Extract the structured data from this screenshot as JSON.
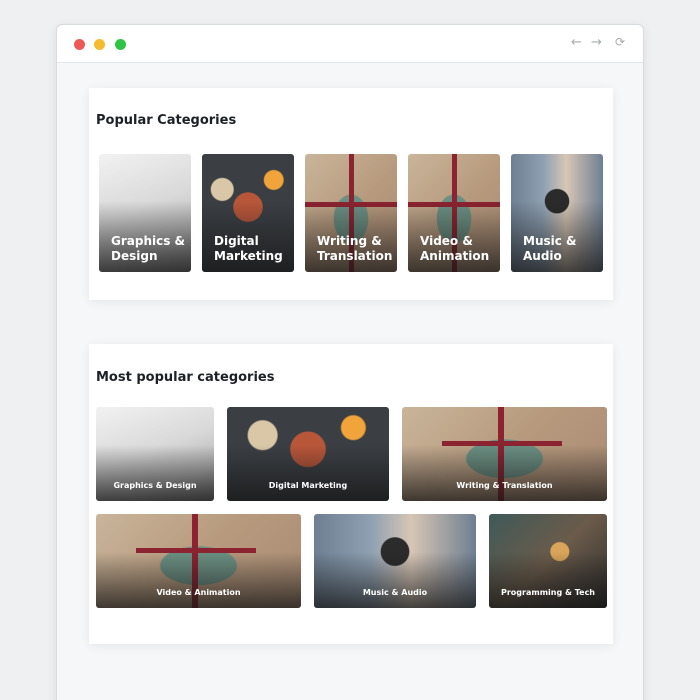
{
  "window": {
    "nav_back": "←",
    "nav_forward": "→",
    "nav_reload": "⟳"
  },
  "popular": {
    "title": "Popular Categories",
    "items": [
      {
        "label": "Graphics & Design",
        "image": "jewelry-photo"
      },
      {
        "label": "Digital Marketing",
        "image": "food-photo"
      },
      {
        "label": "Writing & Translation",
        "image": "gift-photo"
      },
      {
        "label": "Video & Animation",
        "image": "gift-photo"
      },
      {
        "label": "Music & Audio",
        "image": "camera-photo"
      }
    ]
  },
  "most_popular": {
    "title": "Most popular categories",
    "items": [
      {
        "label": "Graphics & Design",
        "image": "jewelry-photo"
      },
      {
        "label": "Digital Marketing",
        "image": "food-photo"
      },
      {
        "label": "Writing & Translation",
        "image": "gift-photo"
      },
      {
        "label": "Video & Animation",
        "image": "gift-photo"
      },
      {
        "label": "Music & Audio",
        "image": "camera-photo"
      },
      {
        "label": "Programming & Tech",
        "image": "drinks-photo"
      }
    ]
  },
  "colors": {
    "dot_red": "#ed5a55",
    "dot_yellow": "#f3bb2e",
    "dot_green": "#2ec445"
  }
}
